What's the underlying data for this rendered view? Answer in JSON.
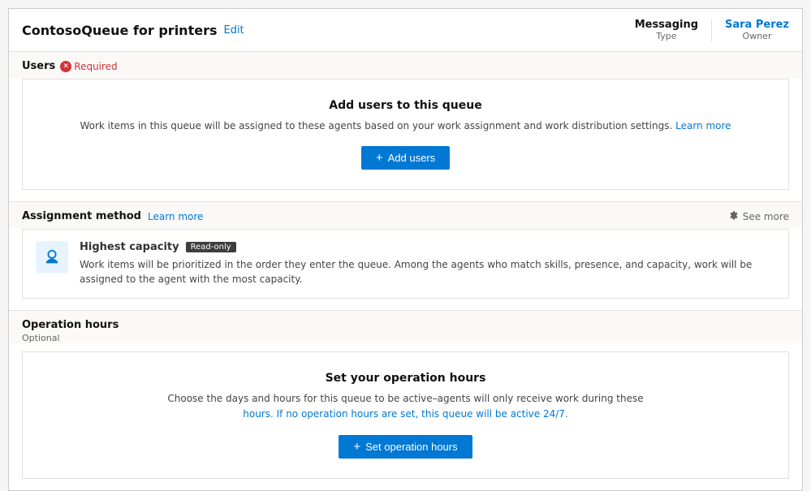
{
  "header": {
    "title": "ContosoQueue for printers",
    "edit_label": "Edit",
    "meta": {
      "type_value": "Messaging",
      "type_label": "Type",
      "owner_value": "Sara Perez",
      "owner_label": "Owner"
    }
  },
  "users_section": {
    "label": "Users",
    "required_text": "Required",
    "panel": {
      "heading": "Add users to this queue",
      "description_start": "Work items in this queue will be assigned to these agents based on your work assignment and work distribution settings.",
      "learn_more_label": "Learn more",
      "add_button_label": "Add users"
    }
  },
  "assignment_section": {
    "label": "Assignment method",
    "learn_more_label": "Learn more",
    "see_more_label": "See more",
    "card": {
      "name": "Highest capacity",
      "readonly_badge": "Read-only",
      "description": "Work items will be prioritized in the order they enter the queue. Among the agents who match skills, presence, and capacity, work will be assigned to the agent with the most capacity."
    }
  },
  "operation_section": {
    "label": "Operation hours",
    "optional_label": "Optional",
    "panel": {
      "heading": "Set your operation hours",
      "description_line1": "Choose the days and hours for this queue to be active–agents will only receive work during these",
      "description_line2": "hours. If no operation hours are set, this queue will be active 24/7.",
      "set_button_label": "Set operation hours"
    }
  }
}
